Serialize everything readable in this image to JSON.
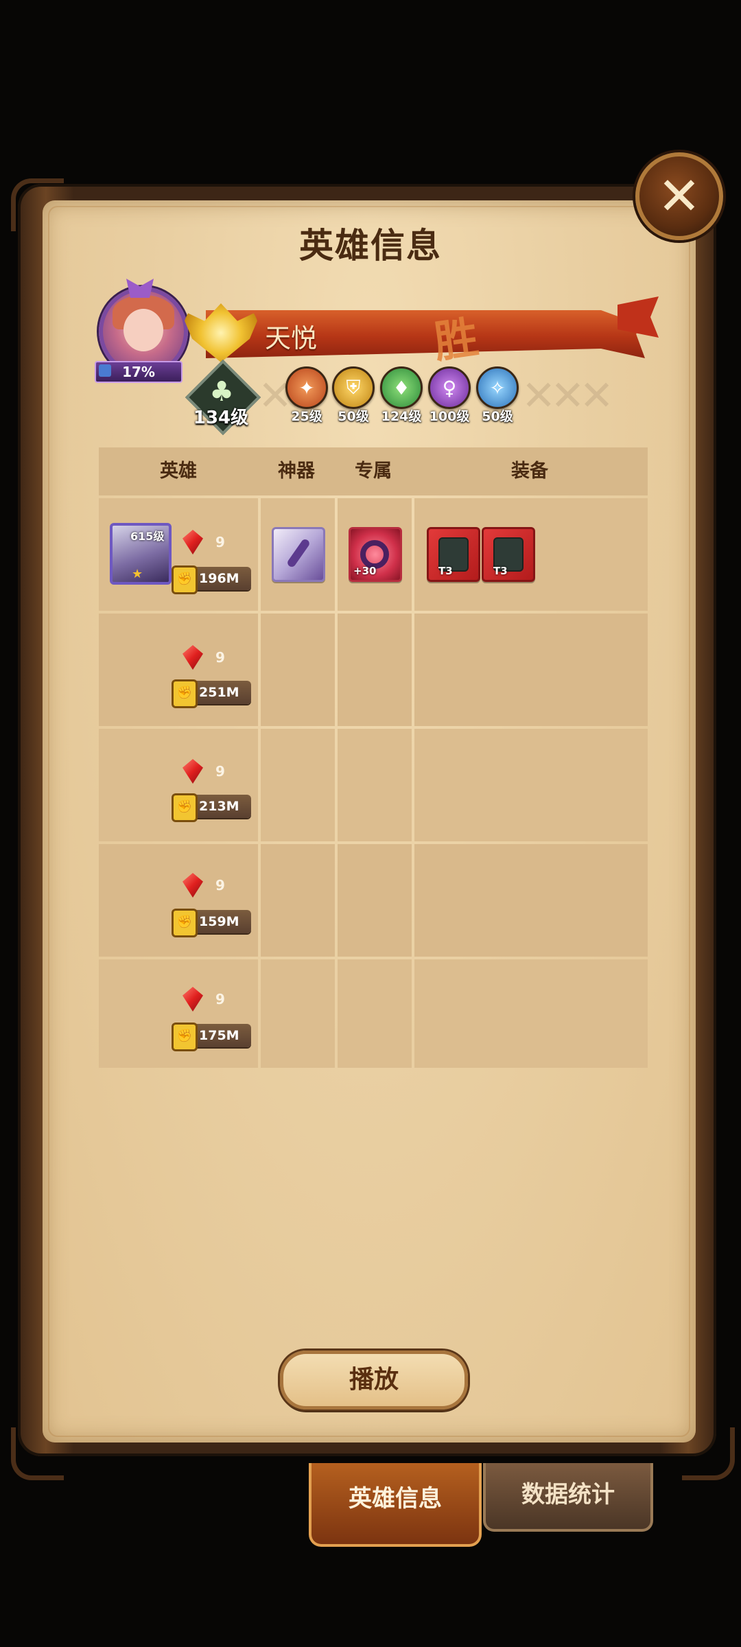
{
  "panel_title": "英雄信息",
  "close_label": "✕",
  "player": {
    "name": "天悦",
    "progress_text": "17%",
    "result_text": "胜",
    "tree_level": "134级"
  },
  "factions": [
    {
      "icon": "lightbearer-icon",
      "level": "25级",
      "color": "#d05a2a"
    },
    {
      "icon": "mauler-icon",
      "level": "50级",
      "color": "#e0a028"
    },
    {
      "icon": "wilder-icon",
      "level": "124级",
      "color": "#3aa04a"
    },
    {
      "icon": "graveborn-icon",
      "level": "100级",
      "color": "#8a3ac0"
    },
    {
      "icon": "celestial-icon",
      "level": "50级",
      "color": "#3a8ad0"
    }
  ],
  "table": {
    "headers": {
      "hero": "英雄",
      "artifact": "神器",
      "exclusive": "专属",
      "equipment": "装备"
    },
    "rows": [
      {
        "hero_level": "615级",
        "stars": "9",
        "power": "196M",
        "has_items": true
      },
      {
        "stars": "9",
        "power": "251M"
      },
      {
        "stars": "9",
        "power": "213M"
      },
      {
        "stars": "9",
        "power": "159M"
      },
      {
        "stars": "9",
        "power": "175M"
      }
    ],
    "row1_items": {
      "exclusive_tag": "+30",
      "gear_tags": [
        "T3",
        "T3"
      ]
    }
  },
  "play_button": "播放",
  "tabs": {
    "hero_info": "英雄信息",
    "statistics": "数据统计"
  }
}
